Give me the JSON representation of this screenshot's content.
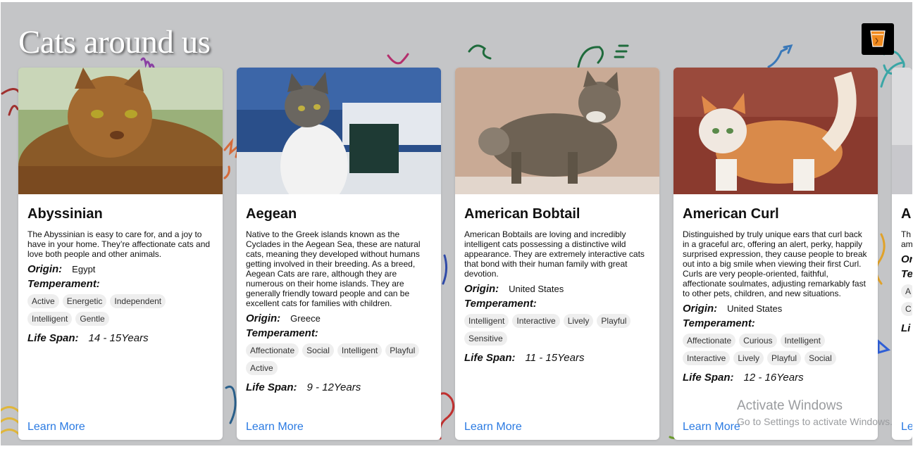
{
  "page": {
    "title": "Cats around us",
    "logo_icon": "orange-glass-logo-icon"
  },
  "cards": [
    {
      "name": "Abyssinian",
      "description": "The Abyssinian is easy to care for, and a joy to have in your home. They’re affectionate cats and love both people and other animals.",
      "origin_label": "Origin:",
      "origin": "Egypt",
      "temperament_label": "Temperament:",
      "temperament": [
        "Active",
        "Energetic",
        "Independent",
        "Intelligent",
        "Gentle"
      ],
      "life_span_label": "Life Span:",
      "life_span": "14 - 15Years",
      "learn_more": "Learn More"
    },
    {
      "name": "Aegean",
      "description": "Native to the Greek islands known as the Cyclades in the Aegean Sea, these are natural cats, meaning they developed without humans getting involved in their breeding. As a breed, Aegean Cats are rare, although they are numerous on their home islands. They are generally friendly toward people and can be excellent cats for families with children.",
      "origin_label": "Origin:",
      "origin": "Greece",
      "temperament_label": "Temperament:",
      "temperament": [
        "Affectionate",
        "Social",
        "Intelligent",
        "Playful",
        "Active"
      ],
      "life_span_label": "Life Span:",
      "life_span": "9 - 12Years",
      "learn_more": "Learn More"
    },
    {
      "name": "American Bobtail",
      "description": "American Bobtails are loving and incredibly intelligent cats possessing a distinctive wild appearance. They are extremely interactive cats that bond with their human family with great devotion.",
      "origin_label": "Origin:",
      "origin": "United States",
      "temperament_label": "Temperament:",
      "temperament": [
        "Intelligent",
        "Interactive",
        "Lively",
        "Playful",
        "Sensitive"
      ],
      "life_span_label": "Life Span:",
      "life_span": "11 - 15Years",
      "learn_more": "Learn More"
    },
    {
      "name": "American Curl",
      "description": "Distinguished by truly unique ears that curl back in a graceful arc, offering an alert, perky, happily surprised expression, they cause people to break out into a big smile when viewing their first Curl. Curls are very people-oriented, faithful, affectionate soulmates, adjusting remarkably fast to other pets, children, and new situations.",
      "origin_label": "Origin:",
      "origin": "United States",
      "temperament_label": "Temperament:",
      "temperament": [
        "Affectionate",
        "Curious",
        "Intelligent",
        "Interactive",
        "Lively",
        "Playful",
        "Social"
      ],
      "life_span_label": "Life Span:",
      "life_span": "12 - 16Years",
      "learn_more": "Learn More"
    }
  ],
  "partial_card": {
    "name": "A",
    "description": "Th rob am",
    "origin_label": "Or",
    "temperament_label": "Te",
    "tag1": "A",
    "tag2": "C",
    "life_span_label": "Li",
    "learn_more": "Le"
  },
  "watermark": {
    "line1": "Activate Windows",
    "line2": "Go to Settings to activate Windows."
  },
  "colors": {
    "background": "#c4c5c7",
    "card": "#ffffff",
    "link": "#2a7ae2",
    "tag": "#eeeeee"
  }
}
